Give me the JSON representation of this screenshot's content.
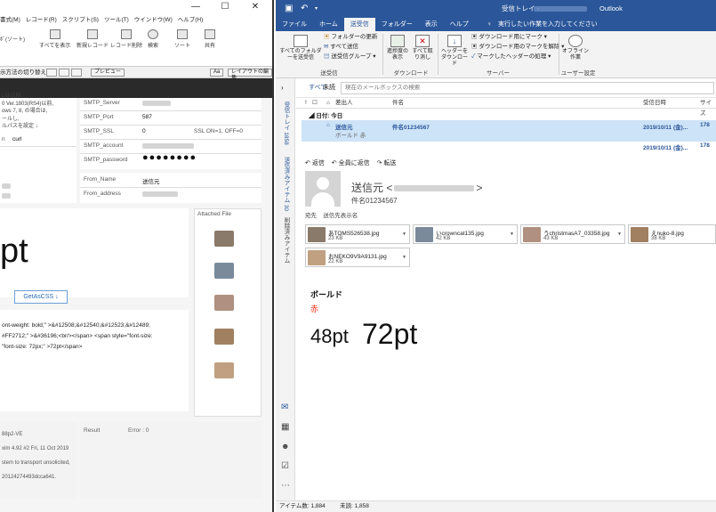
{
  "left_app": {
    "menu": [
      "書式(M)",
      "レコード(R)",
      "スクリプト(S)",
      "ツール(T)",
      "ウインドウ(W)",
      "ヘルプ(H)"
    ],
    "toolbar": {
      "sort_label": "ﾎﾞ(ソート)",
      "show_all": "すべてを表示",
      "new_record": "新規レコード",
      "delete_record": "レコード削除",
      "search": "検索",
      "sort": "ソート",
      "share": "共有"
    },
    "subbar": {
      "display_method": "示方法の切り替え:",
      "preview": "プレビュー",
      "aa": "Aa",
      "edit_layout": "レイアウトの編集"
    },
    "notes": [
      "Lは以前,",
      "0 Ver.1803(RS4)以前,",
      "ows 7, 8, の場合は,",
      "ールし,",
      "ルパスを設定 ↓"
    ],
    "curl_field": {
      "label": "n",
      "value": "curl"
    },
    "smtp_fields": [
      {
        "label": "SMTP_Server",
        "value": ""
      },
      {
        "label": "SMTP_Port",
        "value": "587"
      },
      {
        "label": "SMTP_SSL",
        "value": "0",
        "hint": "SSL ON=1, OFF=0"
      },
      {
        "label": "SMTP_account",
        "value": ""
      },
      {
        "label": "SMTP_password",
        "value": "●●●●●●●●"
      }
    ],
    "from_fields": [
      {
        "label": "From_Name",
        "value": "送信元"
      },
      {
        "label": "From_address",
        "value": ""
      }
    ],
    "big_text": "pt",
    "attached_file_label": "Attached File",
    "getascss_button": "GetAsCSS ↓",
    "html_lines": [
      "ont-weight: bold;\" >&#12508;&#12540;&#12523;&#12489;",
      "#FF2712;\" >&#36196;<br/></span> <span style=\"font-size:",
      "\"font-size: 72px;\" >72pt</span>"
    ],
    "log_lines": [
      "88p2-VE",
      "xim 4.92 #2 Fri, 11 Oct 2019",
      "stem to transport unsolicited,",
      "20124274493dcca641."
    ],
    "result_label": "Result",
    "error_label": "Error : 0"
  },
  "outlook": {
    "window_title": "受信トレイ -",
    "app_name": "Outlook",
    "tabs": [
      "ファイル",
      "ホーム",
      "送受信",
      "フォルダー",
      "表示",
      "ヘルプ"
    ],
    "active_tab": "送受信",
    "tell_me": "実行したい作業を入力してください",
    "ribbon": {
      "send_receive_all": "すべてのフォルダーを送受信",
      "update_folder": "フォルダーの更新",
      "send_all": "すべて送信",
      "send_receive_groups": "送受信グループ",
      "group_send_receive": "送受信",
      "show_progress": "進捗度の表示",
      "cancel_all": "すべて取り消し",
      "group_download": "ダウンロード",
      "download_headers": "ヘッダーをダウンロード",
      "mark_download": "ダウンロード用にマーク",
      "unmark_download": "ダウンロード用のマークを解除",
      "process_marked": "マークしたヘッダーの処理",
      "group_server": "サーバー",
      "work_offline": "オフライン作業",
      "group_user": "ユーザー設定"
    },
    "folder_pane": {
      "inbox": "受信トレイ 1858",
      "sent": "送信済みアイテム 30",
      "deleted": "削除済みアイテム"
    },
    "filter": {
      "all": "すべて",
      "unread": "未読",
      "search_placeholder": "現在のメールボックスの検索"
    },
    "columns": {
      "from": "差出人",
      "subject": "件名",
      "received": "受信日時",
      "size": "サイズ"
    },
    "group_header": "日付: 今日",
    "messages": [
      {
        "from": "送信元",
        "preview": "ボールド 赤",
        "subject": "件名01234567",
        "received": "2019/10/11 (金)...",
        "size": "178"
      },
      {
        "received": "2019/10/11 (金)...",
        "size": "178"
      }
    ],
    "reading": {
      "reply": "返信",
      "reply_all": "全員に返信",
      "forward": "転送",
      "sender_name": "送信元 <",
      "sender_suffix": ">",
      "subject": "件名01234567",
      "to_line": "宛先    送信先表示名",
      "attachments": [
        {
          "name": "あTOMS526538.jpg",
          "size": "23 KB",
          "color": "#8a7a6a"
        },
        {
          "name": "いcrowncat135.jpg",
          "size": "42 KB",
          "color": "#7a8a9a"
        },
        {
          "name": "うchristmasA7_03358.jpg",
          "size": "43 KB",
          "color": "#b09080"
        },
        {
          "name": "えnuko-8.jpg",
          "size": "38 KB",
          "color": "#a08060"
        },
        {
          "name": "おNEKO9V9A9131.jpg",
          "size": "22 KB",
          "color": "#c0a080"
        }
      ],
      "body_bold": "ボールド",
      "body_red": "赤",
      "body_48": "48pt",
      "body_72": "72pt"
    },
    "status": {
      "items": "アイテム数: 1,884",
      "unread": "未読: 1,858"
    }
  },
  "colors": {
    "outlook_blue": "#2b579a",
    "red": "#ff2712"
  }
}
